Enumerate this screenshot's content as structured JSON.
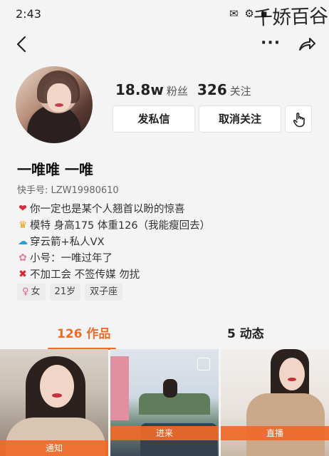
{
  "status_bar": {
    "time": "2:43",
    "icons": "✉ ⚙ ▪",
    "watermark": "千娇百谷"
  },
  "profile": {
    "fans_count": "18.8w",
    "fans_label": "粉丝",
    "following_count": "326",
    "following_label": "关注",
    "message_button": "发私信",
    "unfollow_button": "取消关注",
    "name": "一唯唯 一唯",
    "uid": "快手号: LZW19980610",
    "bio": [
      {
        "icon": "heart-icon",
        "glyph": "❤",
        "text": "你一定也是某个人翘首以盼的惊喜"
      },
      {
        "icon": "crown-icon",
        "glyph": "♛",
        "text": "模特  身高175 体重126（我能瘦回去）"
      },
      {
        "icon": "cloud-icon",
        "glyph": "☁",
        "text": "穿云箭+私人VX"
      },
      {
        "icon": "flower-icon",
        "glyph": "✿",
        "text": "小号：一唯过年了"
      },
      {
        "icon": "cross-icon",
        "glyph": "✖",
        "text": "不加工会 不签传媒 勿扰"
      }
    ],
    "tags": {
      "gender": "女",
      "age": "21岁",
      "zodiac": "双子座"
    }
  },
  "tabs": {
    "works": "126 作品",
    "moments": "5 动态"
  },
  "grid": [
    {
      "label": "通知"
    },
    {
      "label": "进来"
    },
    {
      "label": "直播"
    }
  ],
  "colors": {
    "accent": "#ee6b27",
    "background": "#f4f4f4"
  }
}
